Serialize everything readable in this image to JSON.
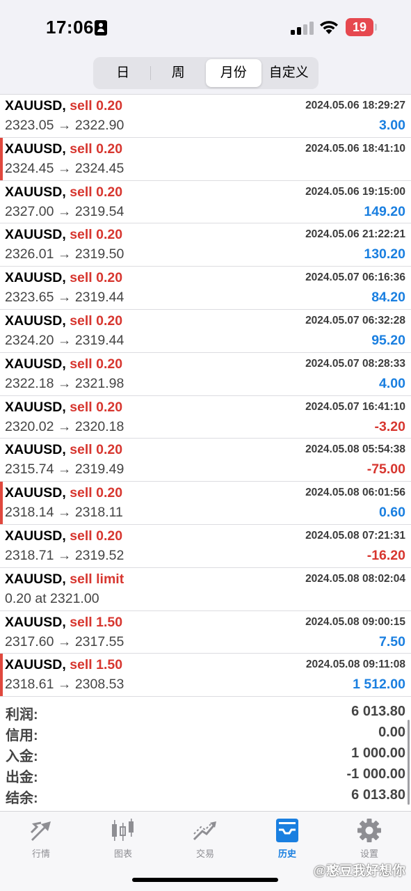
{
  "status": {
    "time": "17:06",
    "battery": "19"
  },
  "periods": [
    "日",
    "周",
    "月份",
    "自定义"
  ],
  "active_period": 2,
  "trades": [
    {
      "symbol": "XAUUSD,",
      "side": "sell 0.20",
      "time": "2024.05.06 18:29:27",
      "prices": "2323.05 → 2322.90",
      "profit": "3.00",
      "negative": false,
      "marked": false
    },
    {
      "symbol": "XAUUSD,",
      "side": "sell 0.20",
      "time": "2024.05.06 18:41:10",
      "prices": "2324.45 → 2324.45",
      "profit": "",
      "negative": false,
      "marked": true
    },
    {
      "symbol": "XAUUSD,",
      "side": "sell 0.20",
      "time": "2024.05.06 19:15:00",
      "prices": "2327.00 → 2319.54",
      "profit": "149.20",
      "negative": false,
      "marked": false
    },
    {
      "symbol": "XAUUSD,",
      "side": "sell 0.20",
      "time": "2024.05.06 21:22:21",
      "prices": "2326.01 → 2319.50",
      "profit": "130.20",
      "negative": false,
      "marked": false
    },
    {
      "symbol": "XAUUSD,",
      "side": "sell 0.20",
      "time": "2024.05.07 06:16:36",
      "prices": "2323.65 → 2319.44",
      "profit": "84.20",
      "negative": false,
      "marked": false
    },
    {
      "symbol": "XAUUSD,",
      "side": "sell 0.20",
      "time": "2024.05.07 06:32:28",
      "prices": "2324.20 → 2319.44",
      "profit": "95.20",
      "negative": false,
      "marked": false
    },
    {
      "symbol": "XAUUSD,",
      "side": "sell 0.20",
      "time": "2024.05.07 08:28:33",
      "prices": "2322.18 → 2321.98",
      "profit": "4.00",
      "negative": false,
      "marked": false
    },
    {
      "symbol": "XAUUSD,",
      "side": "sell 0.20",
      "time": "2024.05.07 16:41:10",
      "prices": "2320.02 → 2320.18",
      "profit": "-3.20",
      "negative": true,
      "marked": false
    },
    {
      "symbol": "XAUUSD,",
      "side": "sell 0.20",
      "time": "2024.05.08 05:54:38",
      "prices": "2315.74 → 2319.49",
      "profit": "-75.00",
      "negative": true,
      "marked": false
    },
    {
      "symbol": "XAUUSD,",
      "side": "sell 0.20",
      "time": "2024.05.08 06:01:56",
      "prices": "2318.14 → 2318.11",
      "profit": "0.60",
      "negative": false,
      "marked": true
    },
    {
      "symbol": "XAUUSD,",
      "side": "sell 0.20",
      "time": "2024.05.08 07:21:31",
      "prices": "2318.71 → 2319.52",
      "profit": "-16.20",
      "negative": true,
      "marked": false
    },
    {
      "symbol": "XAUUSD,",
      "side": "sell limit",
      "time": "2024.05.08 08:02:04",
      "prices": "0.20 at 2321.00",
      "profit": "",
      "negative": false,
      "marked": false
    },
    {
      "symbol": "XAUUSD,",
      "side": "sell 1.50",
      "time": "2024.05.08 09:00:15",
      "prices": "2317.60 → 2317.55",
      "profit": "7.50",
      "negative": false,
      "marked": false
    },
    {
      "symbol": "XAUUSD,",
      "side": "sell 1.50",
      "time": "2024.05.08 09:11:08",
      "prices": "2318.61 → 2308.53",
      "profit": "1 512.00",
      "negative": false,
      "marked": true
    }
  ],
  "summary": [
    {
      "label": "利润:",
      "value": "6 013.80"
    },
    {
      "label": "信用:",
      "value": "0.00"
    },
    {
      "label": "入金:",
      "value": "1 000.00"
    },
    {
      "label": "出金:",
      "value": "-1 000.00"
    },
    {
      "label": "结余:",
      "value": "6 013.80"
    }
  ],
  "tabs": [
    {
      "label": "行情",
      "icon": "quotes-arrows-icon"
    },
    {
      "label": "图表",
      "icon": "candlestick-chart-icon"
    },
    {
      "label": "交易",
      "icon": "trade-trend-icon"
    },
    {
      "label": "历史",
      "icon": "history-inbox-icon"
    },
    {
      "label": "设置",
      "icon": "gear-icon"
    }
  ],
  "active_tab": 3,
  "watermark": "@憨豆我好想你",
  "colors": {
    "sell": "#d7362f",
    "profit_positive": "#1a7fe0",
    "profit_negative": "#d7362f",
    "active_tab": "#1a7fe0"
  }
}
